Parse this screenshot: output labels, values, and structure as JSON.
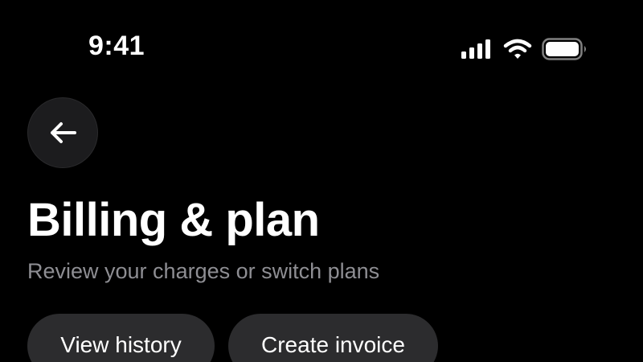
{
  "status_bar": {
    "time": "9:41",
    "icons": [
      "signal-icon",
      "wifi-icon",
      "battery-icon"
    ]
  },
  "header": {
    "back_icon": "arrow-left-icon",
    "title": "Billing & plan",
    "subtitle": "Review your charges or switch plans"
  },
  "actions": {
    "view_history_label": "View history",
    "create_invoice_label": "Create invoice"
  },
  "colors": {
    "background": "#000000",
    "text_primary": "#ffffff",
    "text_secondary": "#8e8e93",
    "button_background": "#2c2c2e"
  }
}
